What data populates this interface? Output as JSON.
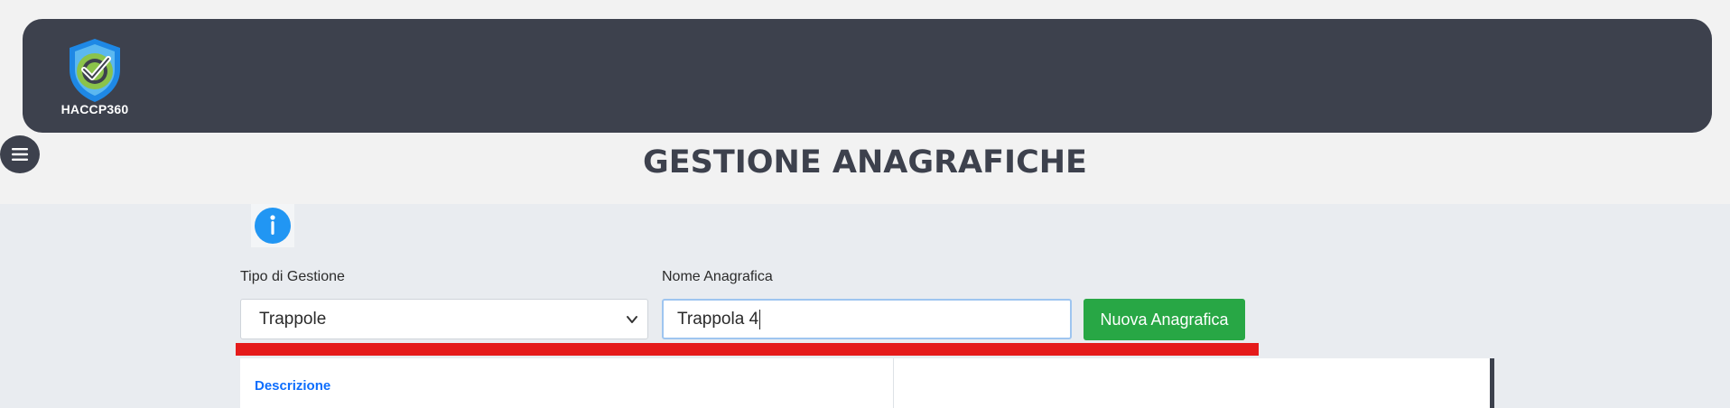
{
  "header": {
    "logo_text": "HACCP360"
  },
  "page_title": "GESTIONE ANAGRAFICHE",
  "form": {
    "tipo_label": "Tipo di Gestione",
    "tipo_value": "Trappole",
    "nome_label": "Nome Anagrafica",
    "nome_value": "Trappola 4",
    "new_button": "Nuova Anagrafica"
  },
  "table": {
    "columns": [
      "Descrizione",
      ""
    ]
  },
  "colors": {
    "header_bg": "#3d414d",
    "primary_button": "#28a745",
    "highlight_bar": "#e51b1b",
    "link_blue": "#0d6efd",
    "info_icon": "#2196f3"
  },
  "icons": [
    "haccp-shield-logo-icon",
    "hamburger-menu-icon",
    "info-icon",
    "chevron-down-icon"
  ]
}
